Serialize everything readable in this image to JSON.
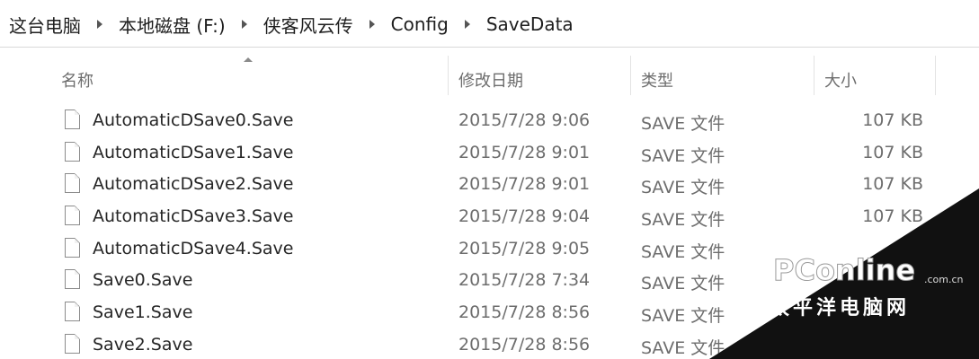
{
  "breadcrumb": {
    "items": [
      "这台电脑",
      "本地磁盘 (F:)",
      "侠客风云传",
      "Config",
      "SaveData"
    ]
  },
  "columns": {
    "name": "名称",
    "date": "修改日期",
    "type": "类型",
    "size": "大小"
  },
  "files": [
    {
      "name": "AutomaticDSave0.Save",
      "date": "2015/7/28 9:06",
      "type": "SAVE 文件",
      "size": "107 KB"
    },
    {
      "name": "AutomaticDSave1.Save",
      "date": "2015/7/28 9:01",
      "type": "SAVE 文件",
      "size": "107 KB"
    },
    {
      "name": "AutomaticDSave2.Save",
      "date": "2015/7/28 9:01",
      "type": "SAVE 文件",
      "size": "107 KB"
    },
    {
      "name": "AutomaticDSave3.Save",
      "date": "2015/7/28 9:04",
      "type": "SAVE 文件",
      "size": "107 KB"
    },
    {
      "name": "AutomaticDSave4.Save",
      "date": "2015/7/28 9:05",
      "type": "SAVE 文件",
      "size": ""
    },
    {
      "name": "Save0.Save",
      "date": "2015/7/28 7:34",
      "type": "SAVE 文件",
      "size": ""
    },
    {
      "name": "Save1.Save",
      "date": "2015/7/28 8:56",
      "type": "SAVE 文件",
      "size": ""
    },
    {
      "name": "Save2.Save",
      "date": "2015/7/28 8:56",
      "type": "SAVE 文件",
      "size": ""
    }
  ],
  "watermark": {
    "logo": "PConline",
    "domain": ".com.cn",
    "text": "太平洋电脑网"
  }
}
